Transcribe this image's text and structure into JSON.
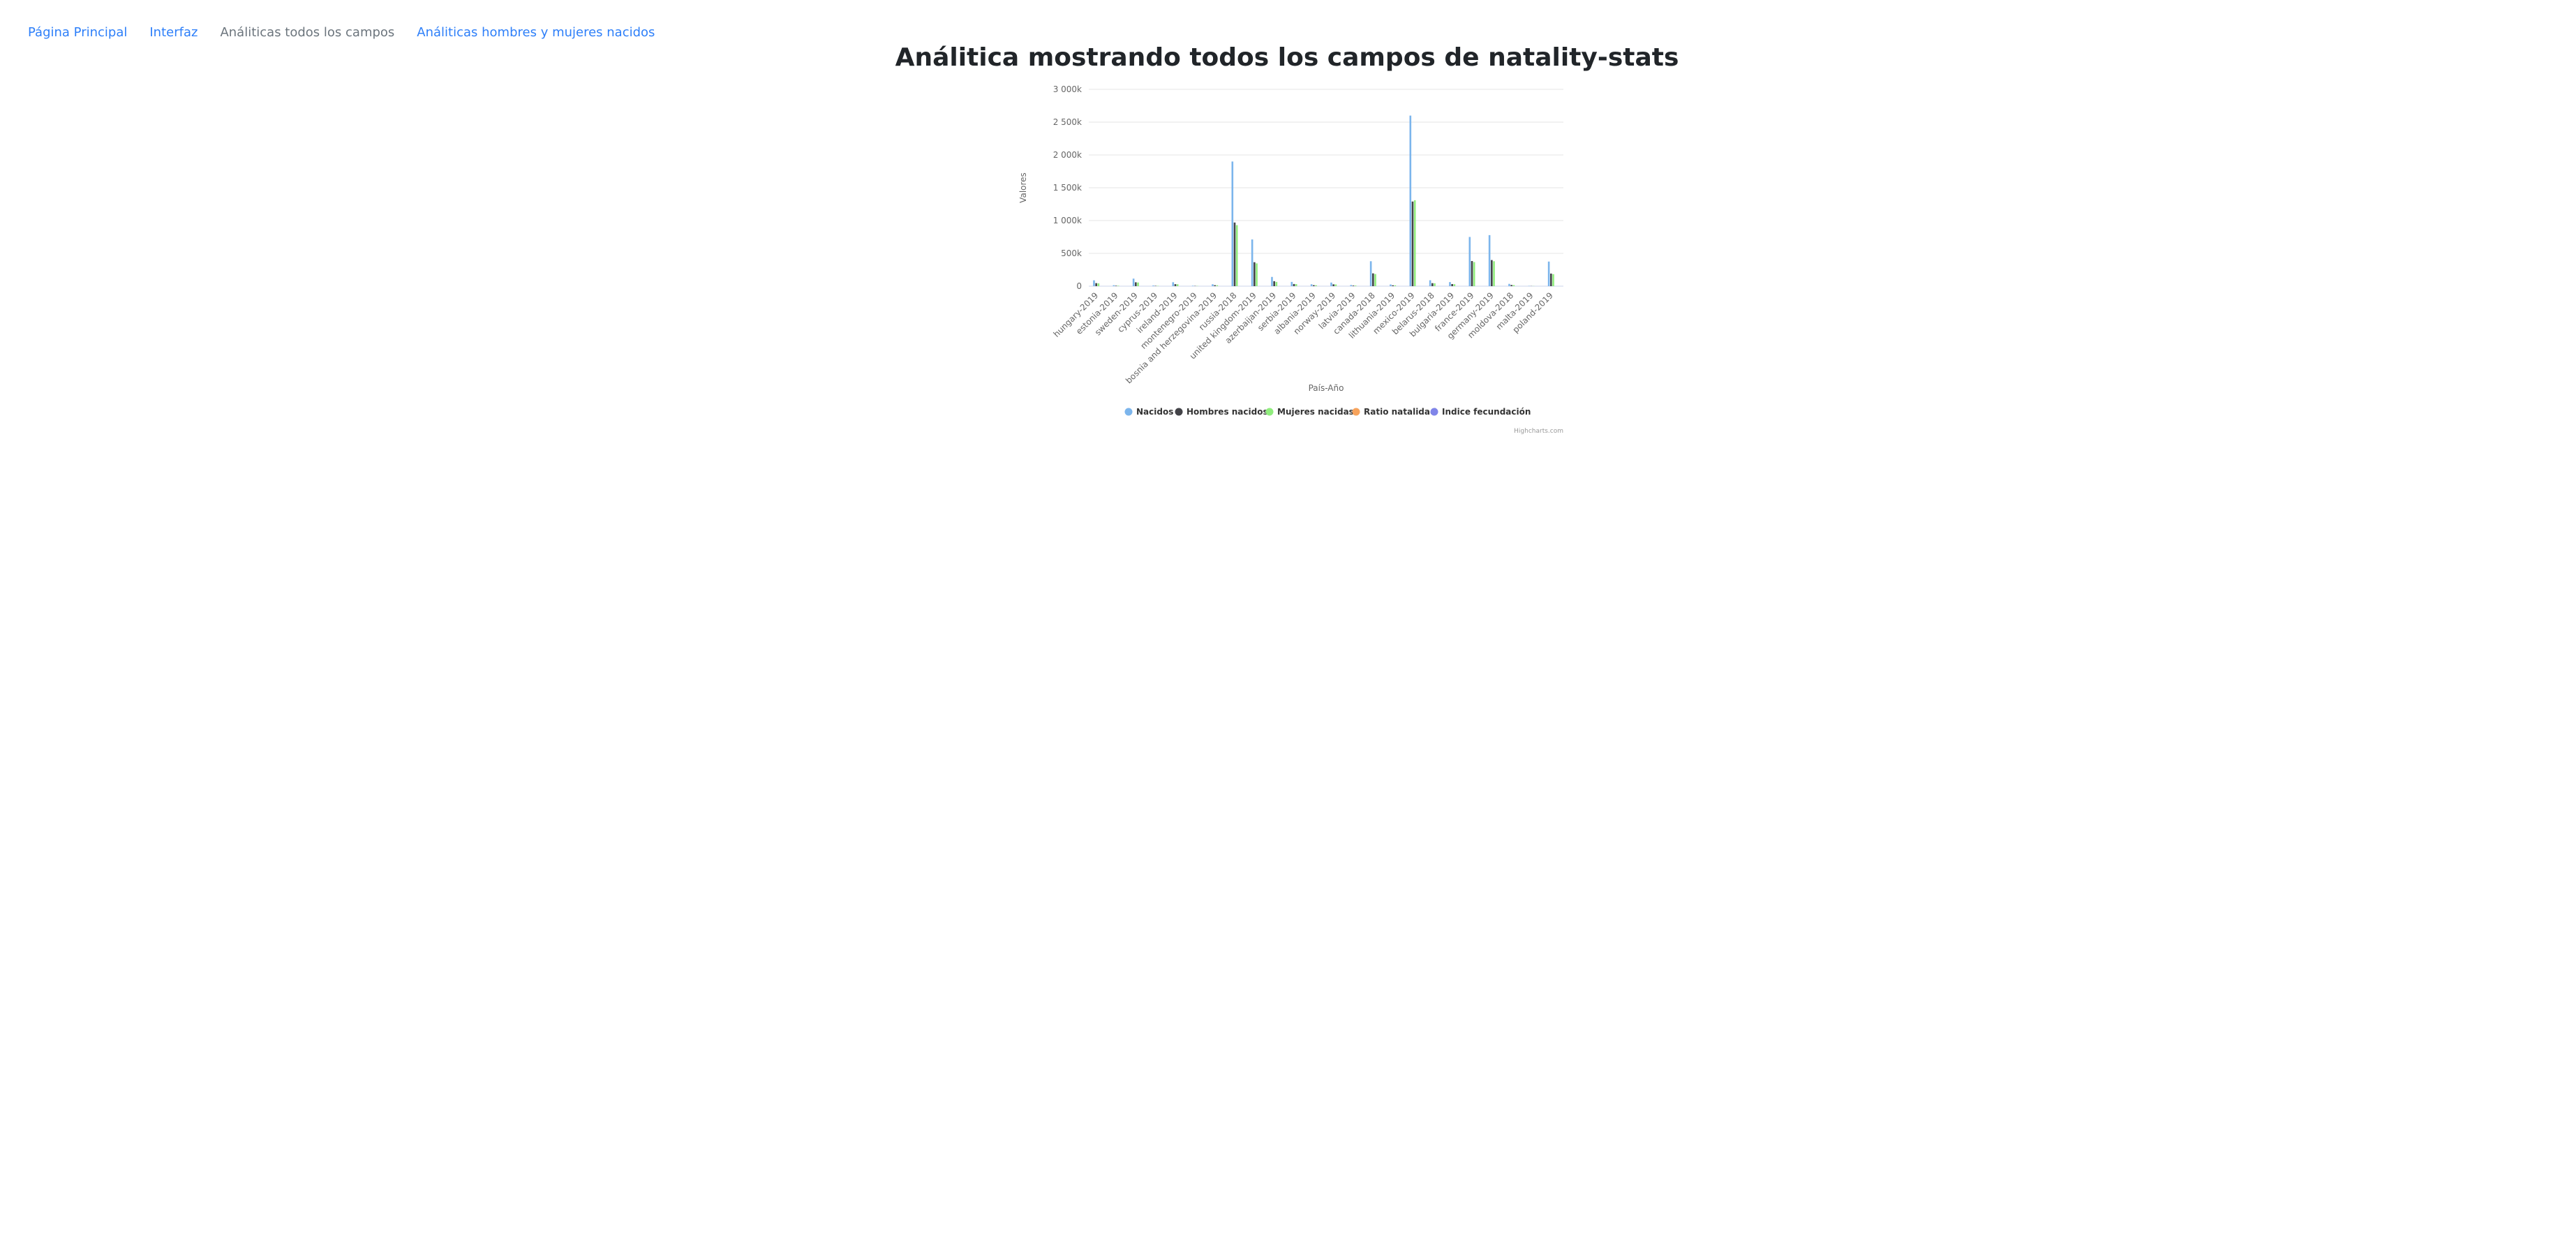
{
  "nav": {
    "items": [
      {
        "label": "Página Principal",
        "active": false
      },
      {
        "label": "Interfaz",
        "active": false
      },
      {
        "label": "Análiticas todos los campos",
        "active": true
      },
      {
        "label": "Análiticas hombres y mujeres nacidos",
        "active": false
      }
    ]
  },
  "page": {
    "title": "Análitica mostrando todos los campos de natality-stats"
  },
  "colors": {
    "link": "#2d7ff9",
    "active_link": "#6c757d",
    "nacidos": "#7cb5ec",
    "hombres": "#434348",
    "mujeres": "#90ed7d",
    "ratio": "#f7a35c",
    "indice": "#8085e9"
  },
  "chart_data": {
    "type": "bar",
    "title": "",
    "xlabel": "País-Año",
    "ylabel": "Valores",
    "ylim": [
      0,
      3000000
    ],
    "yticks": [
      "0",
      "500k",
      "1 000k",
      "1 500k",
      "2 000k",
      "2 500k",
      "3 000k"
    ],
    "grid": true,
    "legend_position": "bottom",
    "credits": "Highcharts.com",
    "categories": [
      "hungary-2019",
      "estonia-2019",
      "sweden-2019",
      "cyprus-2019",
      "ireland-2019",
      "montenegro-2019",
      "bosnia and herzegovina-2019",
      "russia-2018",
      "united kingdom-2019",
      "azerbaijan-2019",
      "serbia-2019",
      "albania-2019",
      "norway-2019",
      "latvia-2019",
      "canada-2018",
      "lithuania-2019",
      "mexico-2019",
      "belarus-2018",
      "bulgaria-2019",
      "france-2019",
      "germany-2019",
      "moldova-2018",
      "malta-2019",
      "poland-2019"
    ],
    "series": [
      {
        "name": "Nacidos",
        "color": "#7cb5ec",
        "values": [
          89000,
          14000,
          115000,
          10000,
          60000,
          7000,
          29000,
          1900000,
          712000,
          141000,
          65000,
          29000,
          55000,
          18000,
          380000,
          26000,
          2600000,
          90000,
          62000,
          750000,
          778000,
          35000,
          4000,
          375000
        ]
      },
      {
        "name": "Hombres nacidos",
        "color": "#434348",
        "values": [
          46000,
          7000,
          59000,
          5000,
          31000,
          3600,
          15000,
          970000,
          365000,
          76000,
          33000,
          15000,
          28000,
          9000,
          195000,
          13000,
          1290000,
          46000,
          32000,
          383000,
          398000,
          18000,
          2000,
          192000
        ]
      },
      {
        "name": "Mujeres nacidas",
        "color": "#90ed7d",
        "values": [
          43000,
          7000,
          56000,
          5000,
          29000,
          3400,
          14000,
          930000,
          347000,
          65000,
          32000,
          14000,
          27000,
          9000,
          185000,
          13000,
          1310000,
          44000,
          30000,
          367000,
          380000,
          17000,
          2000,
          183000
        ]
      },
      {
        "name": "Ratio natalidad",
        "color": "#f7a35c",
        "values": [
          9,
          11,
          11,
          11,
          12,
          11,
          8,
          11,
          11,
          14,
          9,
          10,
          10,
          9,
          10,
          9,
          17,
          9,
          9,
          11,
          9,
          10,
          9,
          10
        ]
      },
      {
        "name": "Indice fecundación",
        "color": "#8085e9",
        "values": [
          1.5,
          1.6,
          1.7,
          1.3,
          1.7,
          1.7,
          1.3,
          1.5,
          1.6,
          1.7,
          1.5,
          1.4,
          1.5,
          1.6,
          1.5,
          1.6,
          2.1,
          1.5,
          1.6,
          1.9,
          1.5,
          1.3,
          1.1,
          1.4
        ]
      }
    ]
  }
}
